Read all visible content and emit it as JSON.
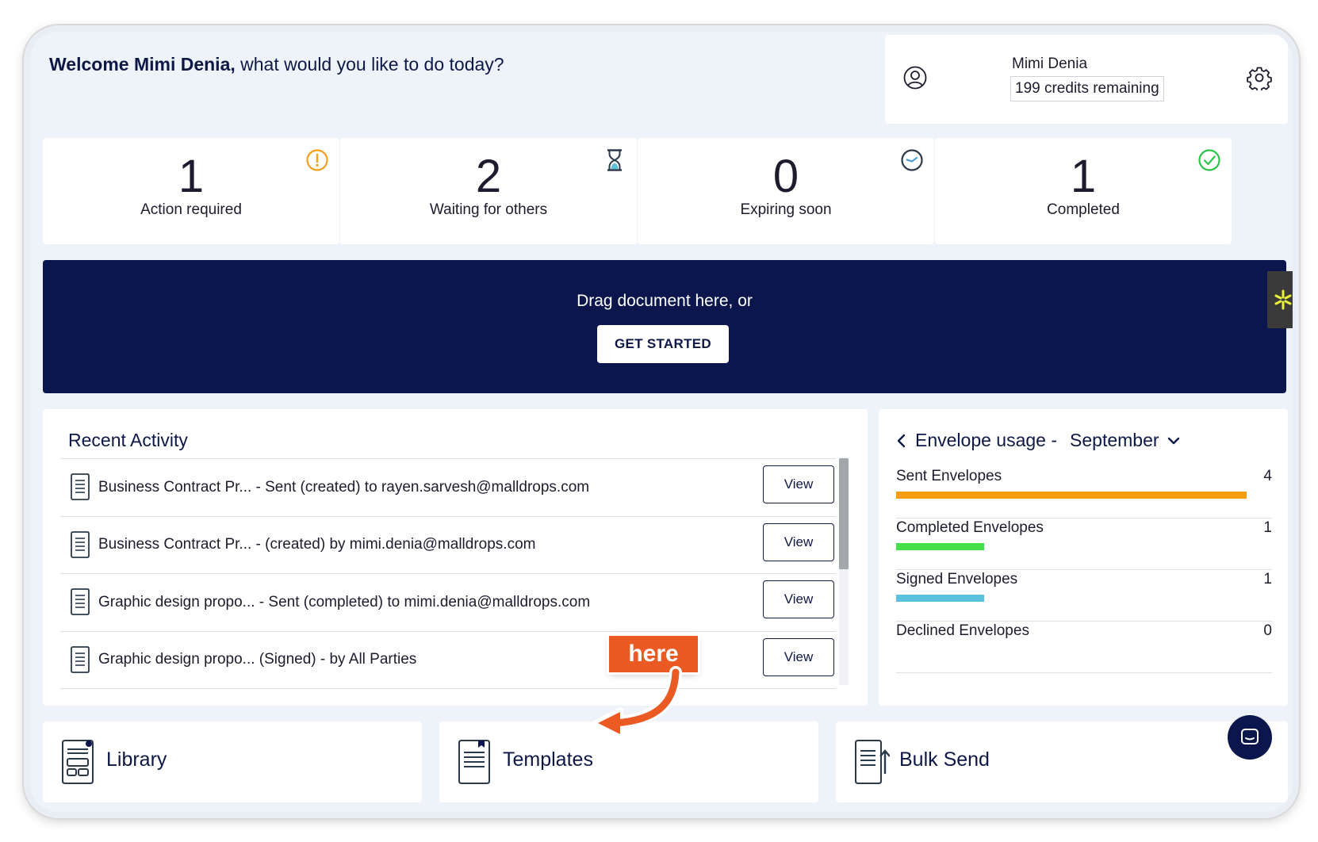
{
  "welcome": {
    "name_part": "Welcome Mimi Denia,",
    "rest": " what would you like to do today?"
  },
  "user": {
    "name": "Mimi Denia",
    "credits": "199 credits remaining",
    "avatar_icon": "user-icon",
    "settings_icon": "gear-icon"
  },
  "stats": [
    {
      "value": "1",
      "label": "Action required",
      "icon": "alert-circle-icon",
      "color": "#f5a01a"
    },
    {
      "value": "2",
      "label": "Waiting for others",
      "icon": "hourglass-icon",
      "color": "#2b3a4a"
    },
    {
      "value": "0",
      "label": "Expiring soon",
      "icon": "clock-icon",
      "color": "#2b3a4a"
    },
    {
      "value": "1",
      "label": "Completed",
      "icon": "check-circle-icon",
      "color": "#2fc24a"
    }
  ],
  "dropzone": {
    "text": "Drag document here, or",
    "button": "GET STARTED"
  },
  "recent": {
    "title": "Recent Activity",
    "items": [
      {
        "text": "Business Contract Pr... - Sent (created) to rayen.sarvesh@malldrops.com",
        "action": "View"
      },
      {
        "text": "Business Contract Pr... - (created) by mimi.denia@malldrops.com",
        "action": "View"
      },
      {
        "text": "Graphic design propo... - Sent (completed) to mimi.denia@malldrops.com",
        "action": "View"
      },
      {
        "text": "Graphic design propo... (Signed) - by All Parties",
        "action": "View"
      }
    ]
  },
  "usage": {
    "title": "Envelope usage -",
    "month": "September",
    "items": [
      {
        "name": "Sent Envelopes",
        "count": "4",
        "fraction": 1.0,
        "color": "#f79d0f"
      },
      {
        "name": "Completed Envelopes",
        "count": "1",
        "fraction": 0.25,
        "color": "#44e048"
      },
      {
        "name": "Signed Envelopes",
        "count": "1",
        "fraction": 0.25,
        "color": "#5bc0dc"
      },
      {
        "name": "Declined Envelopes",
        "count": "0",
        "fraction": 0,
        "color": "#cccccc"
      }
    ]
  },
  "shortcuts": {
    "library": "Library",
    "templates": "Templates",
    "bulk_send": "Bulk Send"
  },
  "annotation": {
    "label": "here",
    "color": "#ec5a24"
  },
  "chat_icon": "chat-icon"
}
